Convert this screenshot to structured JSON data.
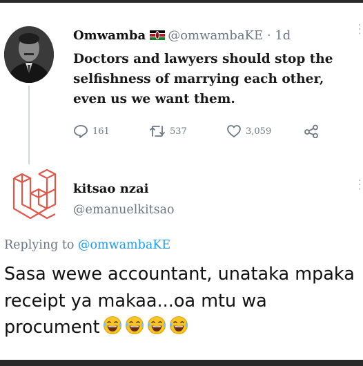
{
  "tweet": {
    "display_name": "Omwamba",
    "flag_icon": "kenya-flag-icon",
    "handle": "@omwambaKE",
    "time_separator": " · ",
    "time": "1d",
    "text": "Doctors and lawyers should stop the selfishness of marrying each other, even us  we want them.",
    "reply_count": "161",
    "retweet_count": "537",
    "like_count": "3,059"
  },
  "reply": {
    "display_name": "kitsao nzai",
    "handle": "@emanuelkitsao",
    "replying_to_label": "Replying to ",
    "replying_to_handle": "@omwambaKE",
    "text": "Sasa wewe accountant, unataka mpaka receipt ya makaa...oa mtu wa procument",
    "emoji_count": 4,
    "emoji_icon": "face-with-tears-of-joy-icon"
  },
  "colors": {
    "accent_link": "#1d9bf0",
    "secondary_text": "#6b7785",
    "reply_avatar_logo": "#e0574a"
  }
}
